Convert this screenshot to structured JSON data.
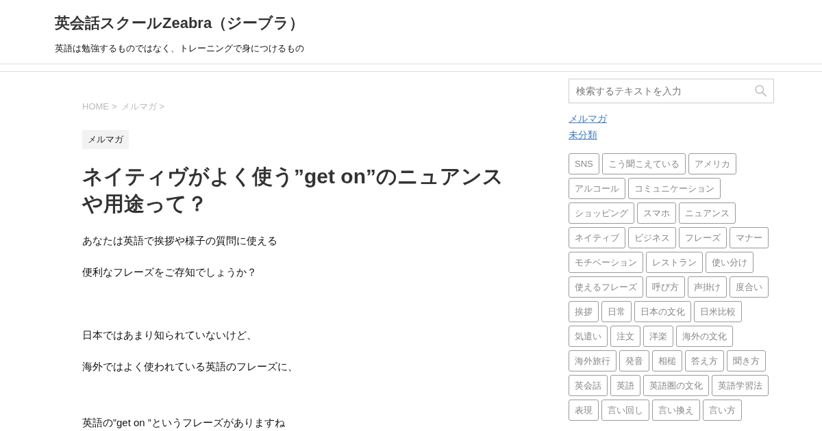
{
  "header": {
    "site_title": "英会話スクールZeabra（ジーブラ）",
    "tagline": "英語は勉強するものではなく、トレーニングで身につけるもの"
  },
  "breadcrumb": {
    "items": [
      "HOME",
      "メルマガ"
    ],
    "separator": ">"
  },
  "article": {
    "category": "メルマガ",
    "title": "ネイティヴがよく使う”get on”のニュアンスや用途って？",
    "sections": [
      {
        "paragraphs": [
          "あなたは英語で挨拶や様子の質問に使える",
          "便利なフレーズをご存知でしょうか？"
        ]
      },
      {
        "paragraphs": [
          "日本ではあまり知られていないけど、",
          "海外ではよく使われている英語のフレーズに、"
        ]
      },
      {
        "paragraphs": [
          "英語の”get on ”というフレーズがありますね"
        ]
      }
    ]
  },
  "sidebar": {
    "search": {
      "placeholder": "検索するテキストを入力"
    },
    "categories": [
      "メルマガ",
      "未分類"
    ],
    "tags": [
      "SNS",
      "こう聞こえている",
      "アメリカ",
      "アルコール",
      "コミュニケーション",
      "ショッピング",
      "スマホ",
      "ニュアンス",
      "ネイティブ",
      "ビジネス",
      "フレーズ",
      "マナー",
      "モチベーション",
      "レストラン",
      "使い分け",
      "使えるフレーズ",
      "呼び方",
      "声掛け",
      "度合い",
      "挨拶",
      "日常",
      "日本の文化",
      "日米比較",
      "気遣い",
      "注文",
      "洋楽",
      "海外の文化",
      "海外旅行",
      "発音",
      "相槌",
      "答え方",
      "聞き方",
      "英会話",
      "英語",
      "英語圏の文化",
      "英語学習法",
      "表現",
      "言い回し",
      "言い換え",
      "言い方"
    ]
  }
}
